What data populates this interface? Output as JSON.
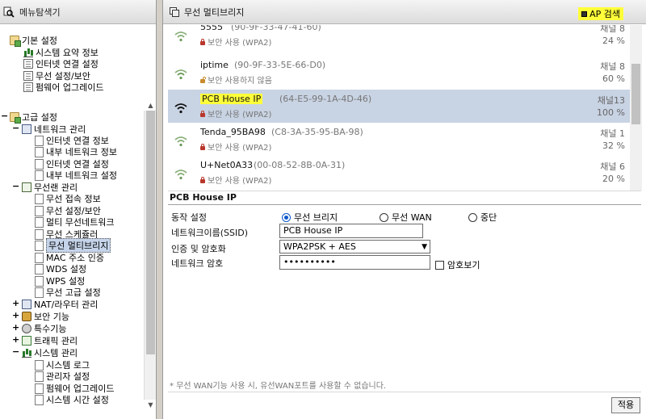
{
  "sidebar": {
    "header": "메뉴탐색기",
    "basic": {
      "label": "기본 설정",
      "children": [
        "시스템 요약 정보",
        "인터넷 연결 설정",
        "무선 설정/보안",
        "펌웨어 업그레이드"
      ]
    },
    "advanced": {
      "label": "고급 설정",
      "network": {
        "label": "네트워크 관리",
        "children": [
          "인터넷 연결 정보",
          "내부 네트워크 정보",
          "인터넷 연결 설정",
          "내부 네트워크 설정"
        ]
      },
      "wireless": {
        "label": "무선랜 관리",
        "children": [
          "무선 접속 정보",
          "무선 설정/보안",
          "멀티 무선네트워크",
          "무선 스케쥴러",
          "무선 멀티브리지",
          "MAC 주소 인증",
          "WDS 설정",
          "WPS 설정",
          "무선 고급 설정"
        ]
      },
      "nat": "NAT/라우터 관리",
      "security": "보안 기능",
      "special": "특수기능",
      "traffic": "트래픽 관리",
      "system": {
        "label": "시스템 관리",
        "children": [
          "시스템 로그",
          "관리자 설정",
          "펌웨어 업그레이드",
          "시스템 시간 설정"
        ]
      }
    },
    "selected": "무선 멀티브리지"
  },
  "main": {
    "title": "무선 멀티브리지",
    "ap_search_label": "AP 검색",
    "ap_list": [
      {
        "ssid": "5555",
        "mac": "(90-9F-33-47-41-60)",
        "security": "보안 사용 (WPA2)",
        "channel": "채널 8",
        "signal": "24 %",
        "locked": true
      },
      {
        "ssid": "iptime",
        "mac": "(90-9F-33-5E-66-D0)",
        "security": "보안 사용하지 않음",
        "channel": "채널 8",
        "signal": "60 %",
        "locked": false
      },
      {
        "ssid": "PCB House IP",
        "mac": "(64-E5-99-1A-4D-46)",
        "security": "보안 사용 (WPA2)",
        "channel": "채널13",
        "signal": "100 %",
        "locked": true
      },
      {
        "ssid": "Tenda_95BA98",
        "mac": "(C8-3A-35-95-BA-98)",
        "security": "보안 사용 (WPA2)",
        "channel": "채널 1",
        "signal": "32 %",
        "locked": true
      },
      {
        "ssid": "U+Net0A33",
        "mac": "(00-08-52-8B-0A-31)",
        "security": "보안 사용 (WPA2)",
        "channel": "채널 6",
        "signal": "20 %",
        "locked": true
      }
    ],
    "selected_ssid": "PCB House IP",
    "form": {
      "section_title": "PCB House IP",
      "mode_label": "동작 설정",
      "mode_options": [
        "무선 브리지",
        "무선 WAN",
        "중단"
      ],
      "mode_selected": "무선 브리지",
      "ssid_label": "네트워크이름(SSID)",
      "ssid_value": "PCB House IP",
      "auth_label": "인증 및 암호화",
      "auth_value": "WPA2PSK + AES",
      "password_label": "네트워크 암호",
      "password_value": "••••••••••",
      "show_password_label": "암호보기"
    },
    "note": "* 무선 WAN기능 사용 시, 유선WAN포트를 사용할 수 없습니다.",
    "apply_label": "적용"
  },
  "colors": {
    "highlight": "#ffff3a",
    "selected_row": "#c8d3e3",
    "wifi_icon": "#6a9a5a"
  }
}
